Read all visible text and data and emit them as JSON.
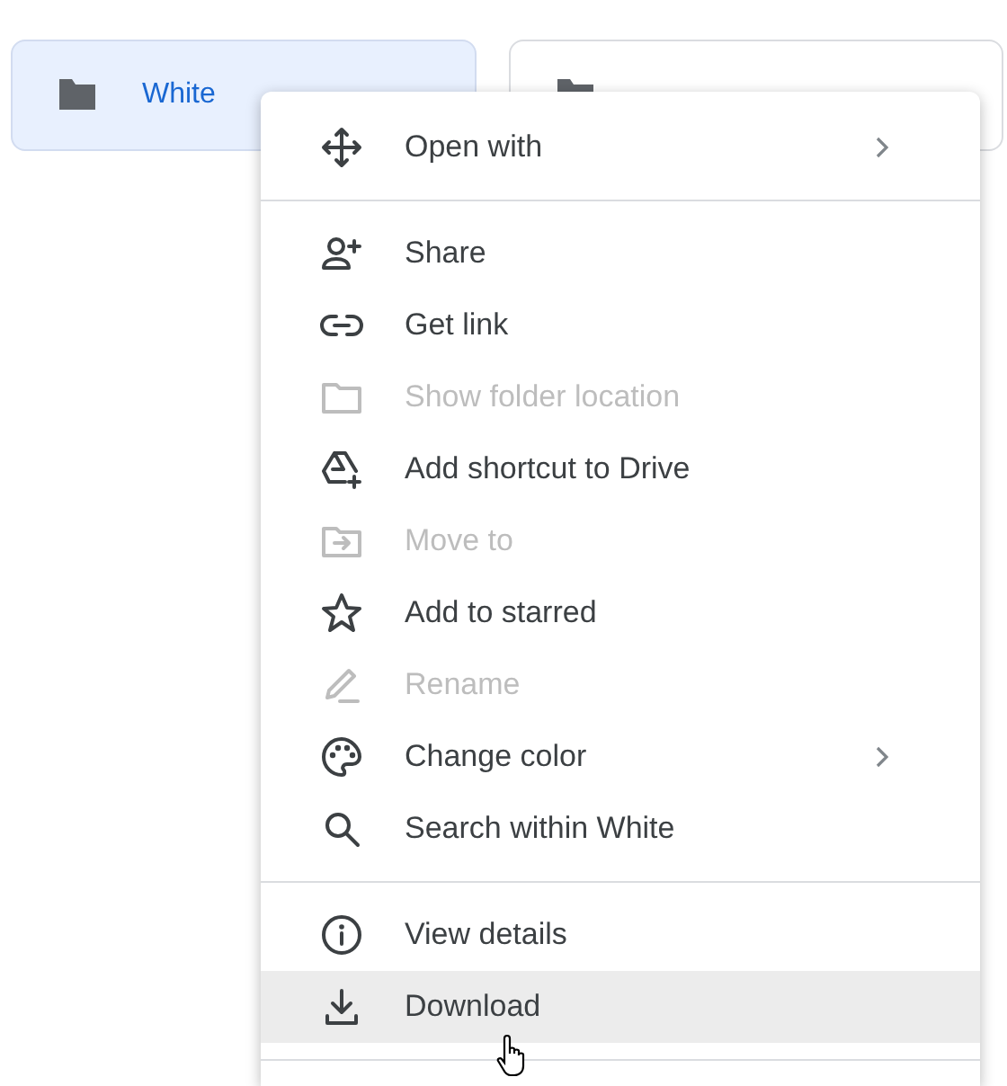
{
  "folders": [
    {
      "name": "White",
      "selected": true
    },
    {
      "selected": false
    }
  ],
  "context_menu": {
    "sections": [
      {
        "items": [
          {
            "label": "Open with",
            "disabled": false,
            "submenu": true,
            "hovered": false
          }
        ]
      },
      {
        "items": [
          {
            "label": "Share",
            "disabled": false,
            "submenu": false,
            "hovered": false
          },
          {
            "label": "Get link",
            "disabled": false,
            "submenu": false,
            "hovered": false
          },
          {
            "label": "Show folder location",
            "disabled": true,
            "submenu": false,
            "hovered": false
          },
          {
            "label": "Add shortcut to Drive",
            "disabled": false,
            "submenu": false,
            "hovered": false
          },
          {
            "label": "Move to",
            "disabled": true,
            "submenu": false,
            "hovered": false
          },
          {
            "label": "Add to starred",
            "disabled": false,
            "submenu": false,
            "hovered": false
          },
          {
            "label": "Rename",
            "disabled": true,
            "submenu": false,
            "hovered": false
          },
          {
            "label": "Change color",
            "disabled": false,
            "submenu": true,
            "hovered": false
          },
          {
            "label": "Search within White",
            "disabled": false,
            "submenu": false,
            "hovered": false
          }
        ]
      },
      {
        "items": [
          {
            "label": "View details",
            "disabled": false,
            "submenu": false,
            "hovered": false
          },
          {
            "label": "Download",
            "disabled": false,
            "submenu": false,
            "hovered": true
          }
        ]
      }
    ]
  }
}
